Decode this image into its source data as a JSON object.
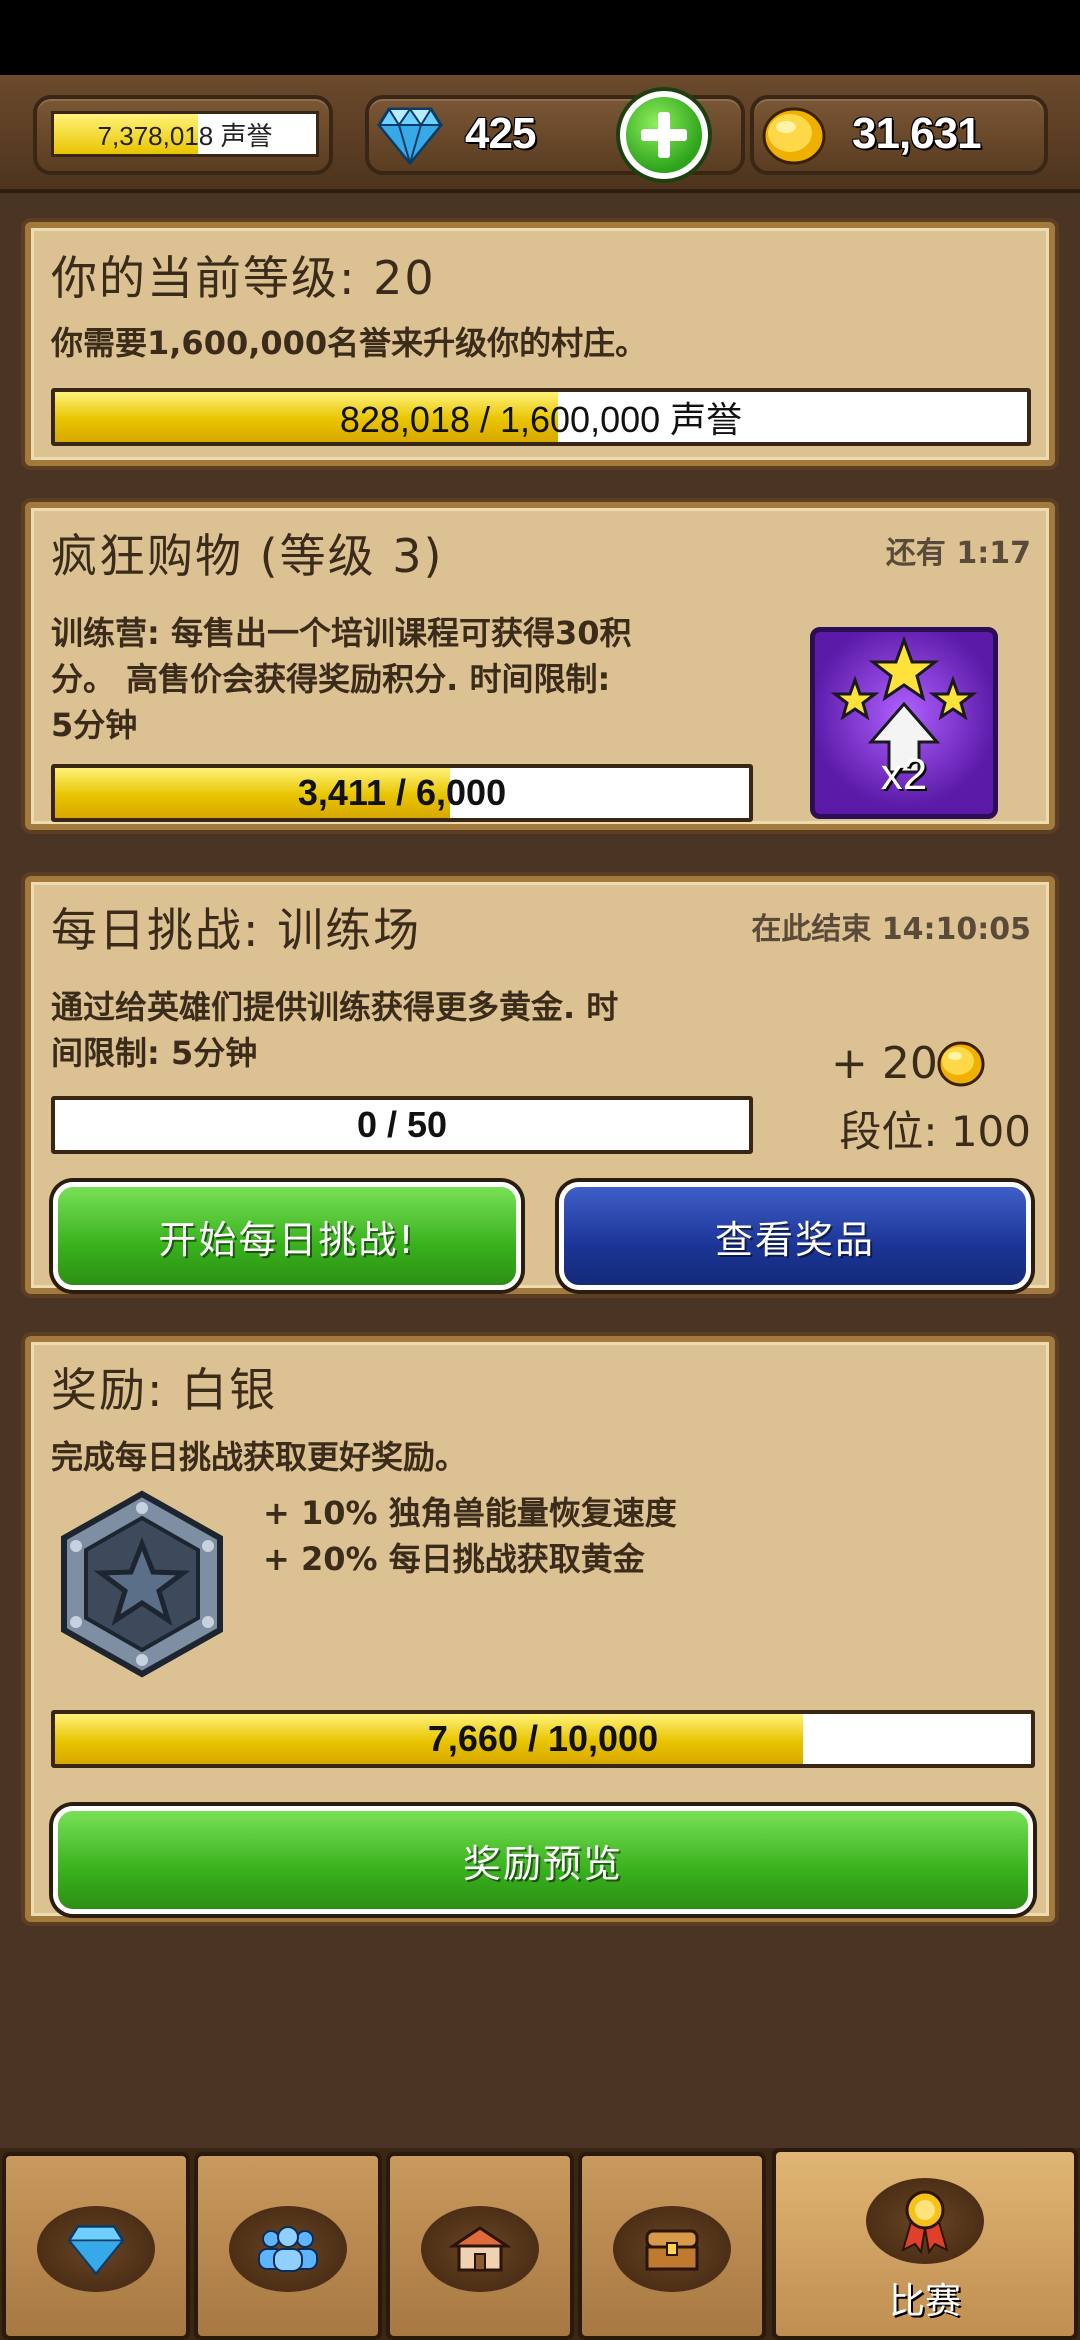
{
  "topbar": {
    "fame_text": "7,378,018 声誉",
    "fame_fill": 0.55,
    "gems": "425",
    "gold": "31,631"
  },
  "level_panel": {
    "title": "你的当前等级: 20",
    "description": "你需要1,600,000名誉来升级你的村庄。",
    "progress_text": "828,018 / 1,600,000 声誉",
    "progress_fill": 0.5175
  },
  "shopping_panel": {
    "title": "疯狂购物 (等级 3)",
    "time_left": "还有 1:17",
    "description_line1": "训练营: 每售出一个培训课程可获得30积",
    "description_line2": "分。 高售价会获得奖励积分. 时间限制:",
    "description_line3": "5分钟",
    "progress_text": "3,411 / 6,000",
    "progress_fill": 0.5685,
    "boost_label": "x2"
  },
  "challenge_panel": {
    "title": "每日挑战: 训练场",
    "ends_at": "在此结束 14:10:05",
    "description_line1": "通过给英雄们提供训练获得更多黄金. 时",
    "description_line2": "间限制: 5分钟",
    "progress_text": "0 / 50",
    "progress_fill": 0,
    "reward_amount": "+ 20",
    "rank_text": "段位: 100",
    "start_button": "开始每日挑战!",
    "prizes_button": "查看奖品"
  },
  "reward_panel": {
    "title": "奖励: 白银",
    "description": "完成每日挑战获取更好奖励。",
    "bonus1": "+ 10% 独角兽能量恢复速度",
    "bonus2": "+ 20% 每日挑战获取黄金",
    "progress_text": "7,660 / 10,000",
    "progress_fill": 0.766,
    "preview_button": "奖励预览"
  },
  "bottom_nav": {
    "tabs": [
      {
        "icon": "gem-icon"
      },
      {
        "icon": "heroes-icon"
      },
      {
        "icon": "village-icon"
      },
      {
        "icon": "chest-icon"
      },
      {
        "icon": "medal-icon",
        "label": "比赛",
        "active": true
      }
    ]
  },
  "colors": {
    "panel": "#dcc293",
    "progress_fill": "#e8c400",
    "green_button": "#38b11d",
    "blue_button": "#1b3596"
  }
}
